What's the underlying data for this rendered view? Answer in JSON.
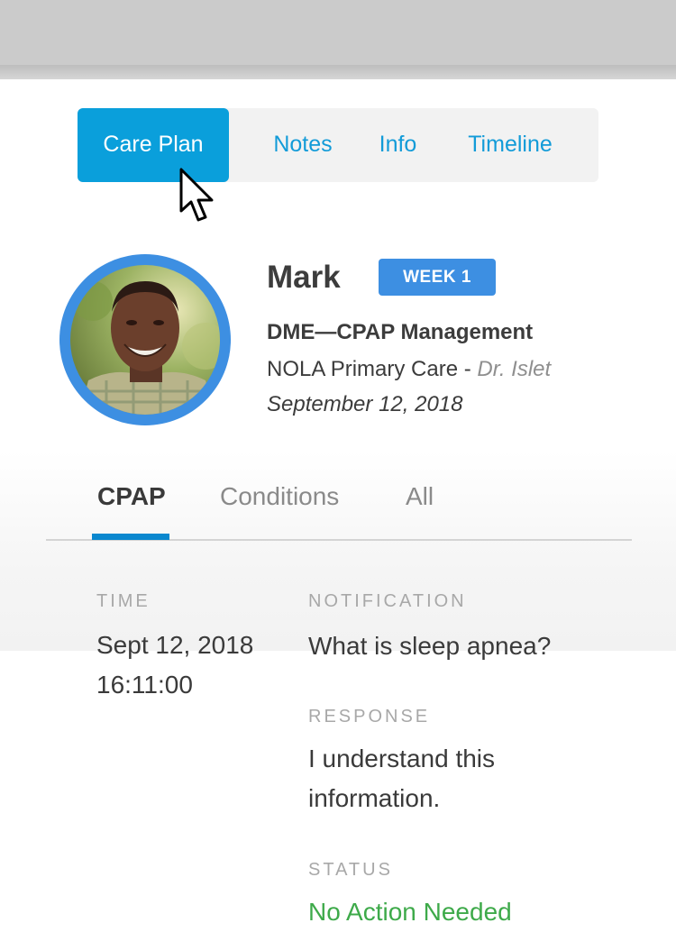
{
  "tabs": [
    {
      "label": "Care Plan",
      "active": true
    },
    {
      "label": "Notes",
      "active": false
    },
    {
      "label": "Info",
      "active": false
    },
    {
      "label": "Timeline",
      "active": false
    }
  ],
  "patient": {
    "name": "Mark",
    "week_badge": "WEEK 1",
    "program": "DME—CPAP Management",
    "clinic": "NOLA Primary Care - ",
    "doctor": "Dr. Islet",
    "date": "September 12, 2018"
  },
  "subtabs": [
    {
      "label": "CPAP",
      "active": true
    },
    {
      "label": "Conditions",
      "active": false
    },
    {
      "label": "All",
      "active": false
    }
  ],
  "detail": {
    "time_label": "TIME",
    "time_date": "Sept 12, 2018",
    "time_clock": "16:11:00",
    "notification_label": "NOTIFICATION",
    "notification_value": "What is sleep apnea?",
    "response_label": "RESPONSE",
    "response_line1": "I understand this",
    "response_line2": "information.",
    "status_label": "STATUS",
    "status_value": "No Action Needed"
  },
  "colors": {
    "accent_blue": "#0a9fdb",
    "badge_blue": "#3d8fe2",
    "status_green": "#3eaa4a"
  },
  "icons": {
    "cursor": "mouse-pointer-icon"
  }
}
